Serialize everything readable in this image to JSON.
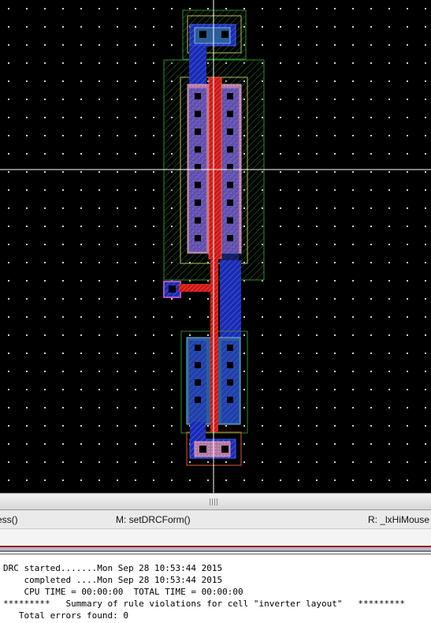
{
  "layout_view": {
    "background": "#000000",
    "grid_dot_color": "#cfcfcf",
    "crosshair_color": "#ffffff",
    "layer_colors": {
      "nwell": "#2e8b2e",
      "diffusion": "#3a7a7a",
      "metal1": "#1a2fb0",
      "poly": "#d42020",
      "contact": "#000000",
      "implant": "#c87a3a"
    }
  },
  "splitter": {
    "grip_icon": "grip-icon"
  },
  "mouse_bindings": {
    "left": "ess()",
    "middle": "M: setDRCForm()",
    "right": "R: _lxHiMouse"
  },
  "log": {
    "lines": [
      "DRC started.......Mon Sep 28 10:53:44 2015",
      "    completed ....Mon Sep 28 10:53:44 2015",
      "    CPU TIME = 00:00:00  TOTAL TIME = 00:00:00",
      "*********   Summary of rule violations for cell \"inverter layout\"   *********",
      "   Total errors found: 0"
    ]
  }
}
